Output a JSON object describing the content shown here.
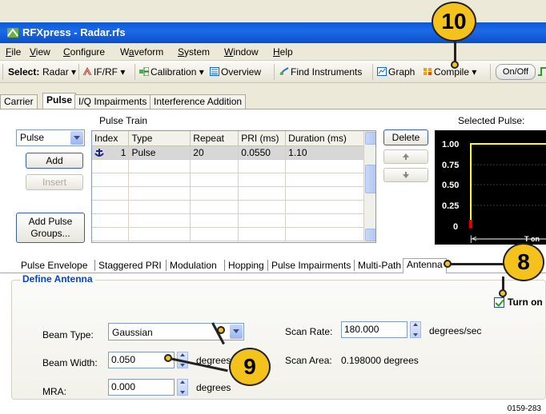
{
  "window": {
    "title": "RFXpress - Radar.rfs",
    "app_icon": "rfxpress-app-icon"
  },
  "menu": [
    "File",
    "View",
    "Configure",
    "Waveform",
    "System",
    "Window",
    "Help"
  ],
  "menu_mnemonics": [
    "F",
    "V",
    "C",
    "a",
    "S",
    "W",
    "H"
  ],
  "toolbar": {
    "select_label": "Select:",
    "select_value": "Radar",
    "ifrf": "IF/RF",
    "calibration": "Calibration",
    "overview": "Overview",
    "find_instruments": "Find Instruments",
    "graph": "Graph",
    "compile": "Compile",
    "onoff": "On/Off"
  },
  "main_tabs": [
    "Carrier",
    "Pulse",
    "I/Q Impairments",
    "Interference Addition"
  ],
  "pulse_train": {
    "title": "Pulse Train",
    "type_select": "Pulse",
    "add": "Add",
    "insert": "Insert",
    "add_pulse_groups": "Add Pulse Groups...",
    "delete": "Delete",
    "columns": [
      "Index",
      "Type",
      "Repeat",
      "PRI (ms)",
      "Duration (ms)"
    ],
    "rows": [
      {
        "index": "1",
        "type": "Pulse",
        "repeat": "20",
        "pri": "0.0550",
        "duration": "1.10"
      }
    ]
  },
  "selected_pulse": {
    "title": "Selected Pulse:",
    "y_ticks": [
      "1.00",
      "0.75",
      "0.50",
      "0.25",
      "0"
    ],
    "x_label_fragment": "T    on"
  },
  "sub_tabs": [
    "Pulse Envelope",
    "Staggered PRI",
    "Modulation",
    "Hopping",
    "Pulse Impairments",
    "Multi-Path",
    "Antenna"
  ],
  "antenna": {
    "group_title": "Define Antenna",
    "turn_on": "Turn on",
    "beam_type_label": "Beam Type:",
    "beam_type_value": "Gaussian",
    "beam_width_label": "Beam Width:",
    "beam_width_value": "0.050",
    "beam_width_unit": "degrees",
    "mra_label": "MRA:",
    "mra_value": "0.000",
    "mra_unit": "degrees",
    "scan_rate_label": "Scan Rate:",
    "scan_rate_value": "180.000",
    "scan_rate_unit": "degrees/sec",
    "scan_area_label": "Scan Area:",
    "scan_area_value": "0.198000 degrees"
  },
  "callouts": {
    "c10": "10",
    "c8": "8",
    "c9": "9"
  },
  "figure_id": "0159-283",
  "colors": {
    "accent_blue": "#0046d5",
    "callout_yellow": "#f4c21c",
    "pulse_line": "#ffff00"
  }
}
